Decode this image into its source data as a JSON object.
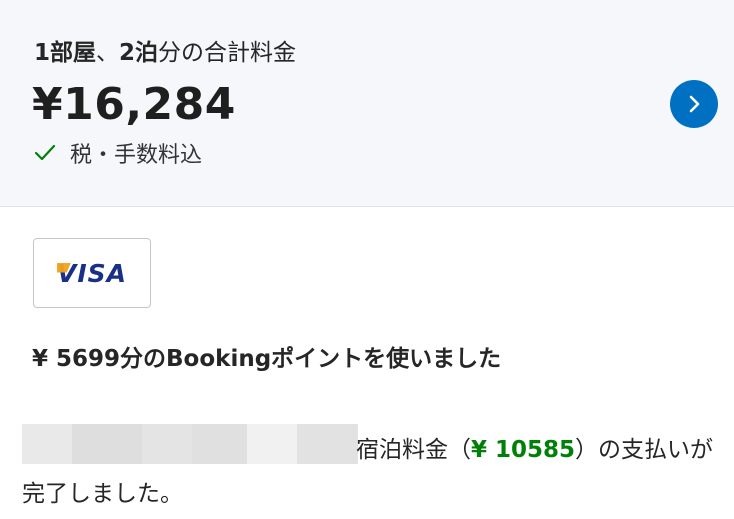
{
  "summary": {
    "rooms_bold": "1部屋",
    "separator": "、",
    "nights_bold": "2泊",
    "total_label": "分の合計料金",
    "price": "¥16,284",
    "tax_note": "税・手数料込"
  },
  "payment": {
    "card_brand": "VISA"
  },
  "points_text": "¥ 5699分のBookingポイントを使いました",
  "message": {
    "prefix": "宿泊料金（",
    "amount": "¥ 10585",
    "suffix": "）の支払いが完了しました。"
  },
  "colors": {
    "accent_blue": "#0071c2",
    "success_green": "#008009",
    "summary_bg": "#f5f7fa"
  },
  "icons": {
    "check": "check-icon",
    "next": "chevron-right-icon"
  }
}
